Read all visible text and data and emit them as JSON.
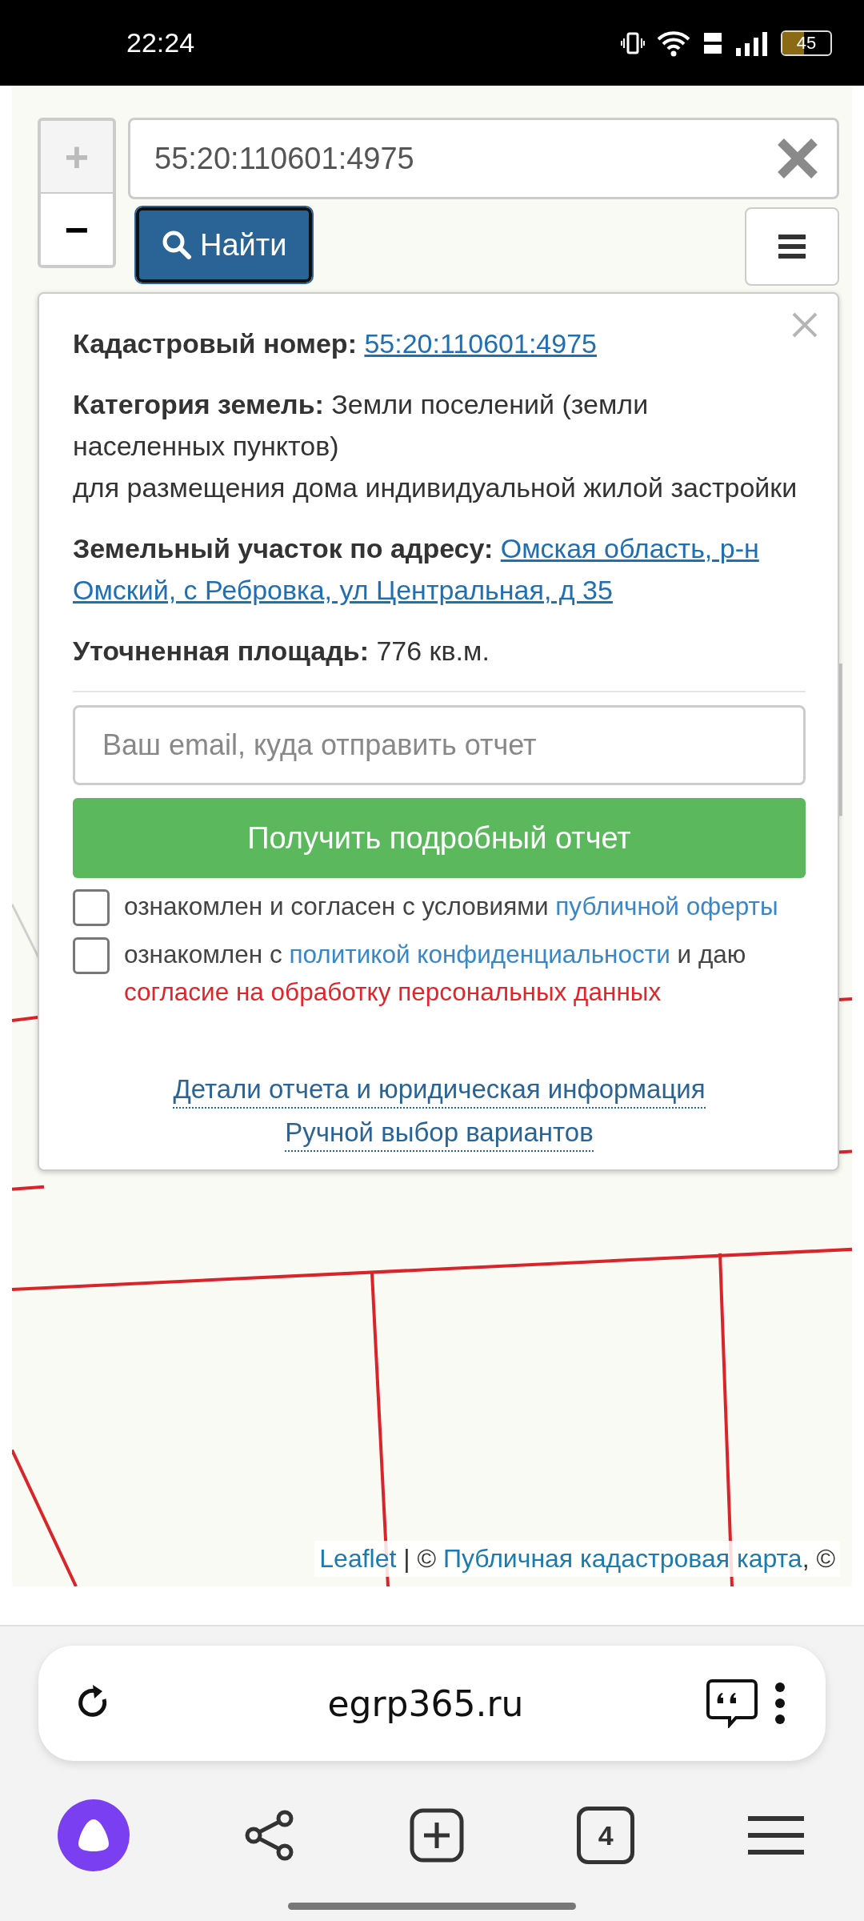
{
  "status_bar": {
    "time": "22:24",
    "battery": "45"
  },
  "search": {
    "value": "55:20:110601:4975",
    "button": "Найти"
  },
  "zoom": {
    "plus": "+",
    "minus": "−"
  },
  "popup": {
    "cadastral": {
      "label": "Кадастровый номер:",
      "value": "55:20:110601:4975"
    },
    "category": {
      "label": "Категория земель:",
      "value": "Земли поселений (земли населенных пунктов)",
      "usage": "для размещения дома индивидуальной жилой застройки"
    },
    "address": {
      "label": "Земельный участок по адресу:",
      "value_lines": [
        "Омская область, р-н",
        "Омский, с Ребровка, ул Центральная, д 35"
      ]
    },
    "area": {
      "label": "Уточненная площадь:",
      "value": "776 кв.м."
    },
    "email": {
      "placeholder": "Ваш email, куда отправить отчет"
    },
    "submit": "Получить подробный отчет",
    "agreements": [
      {
        "checked": false,
        "parts": [
          {
            "kind": "text",
            "text": "ознакомлен и согласен с условиями "
          },
          {
            "kind": "link",
            "text": "публичной оферты"
          }
        ]
      },
      {
        "checked": false,
        "parts": [
          {
            "kind": "text",
            "text": "ознакомлен с "
          },
          {
            "kind": "link",
            "text": "политикой конфиденциальности"
          },
          {
            "kind": "text",
            "text": " и даю "
          },
          {
            "kind": "warning",
            "text": "согласие на обработку персональных данных"
          }
        ]
      }
    ],
    "links": [
      "Детали отчета и юридическая информация",
      "Ручной выбор вариантов"
    ]
  },
  "attribution": [
    {
      "kind": "link",
      "text": "Leaflet"
    },
    {
      "kind": "text",
      "text": " | © "
    },
    {
      "kind": "link",
      "text": "Публичная кадастровая карта"
    },
    {
      "kind": "text",
      "text": ", ©"
    }
  ],
  "browser": {
    "url": "egrp365.ru",
    "tabs_count": "4"
  }
}
